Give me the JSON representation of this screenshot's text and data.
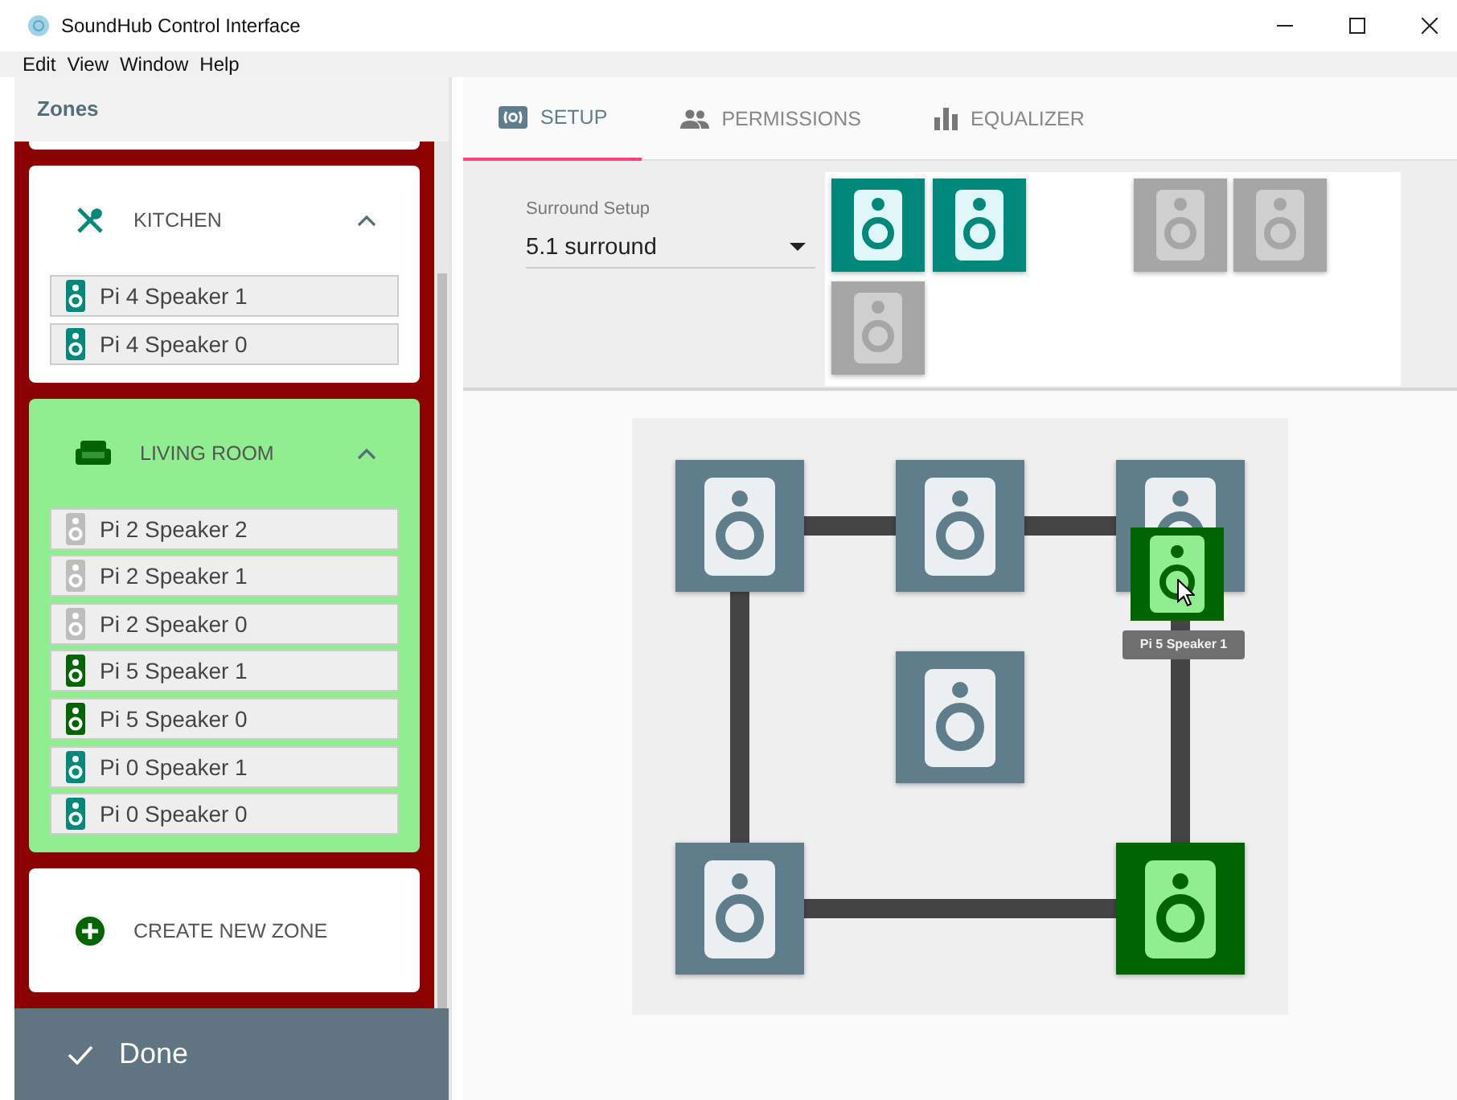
{
  "window": {
    "title": "SoundHub Control Interface"
  },
  "menu": [
    "Edit",
    "View",
    "Window",
    "Help"
  ],
  "sidebar": {
    "title": "Zones",
    "zones": [
      {
        "kind": "kitchen",
        "name": "KITCHEN",
        "color": "#ffffff",
        "expanded": true,
        "speakers": [
          {
            "name": "Pi 4 Speaker 1",
            "color": "#00897b"
          },
          {
            "name": "Pi 4 Speaker 0",
            "color": "#00897b"
          }
        ]
      },
      {
        "kind": "living_room",
        "name": "LIVING ROOM",
        "color": "#90ee90",
        "expanded": true,
        "speakers": [
          {
            "name": "Pi 2 Speaker 2",
            "color": "#bdbdbd"
          },
          {
            "name": "Pi 2 Speaker 1",
            "color": "#bdbdbd"
          },
          {
            "name": "Pi 2 Speaker 0",
            "color": "#bdbdbd"
          },
          {
            "name": "Pi 5 Speaker 1",
            "color": "#006400"
          },
          {
            "name": "Pi 5 Speaker 0",
            "color": "#006400"
          },
          {
            "name": "Pi 0 Speaker 1",
            "color": "#00897b"
          },
          {
            "name": "Pi 0 Speaker 0",
            "color": "#00897b"
          }
        ]
      }
    ],
    "create_zone": "CREATE NEW ZONE",
    "done_button": "Done"
  },
  "tabs": [
    {
      "kind": "setup",
      "label": "SETUP",
      "selected": true
    },
    {
      "kind": "permissions",
      "label": "PERMISSIONS",
      "selected": false
    },
    {
      "kind": "equalizer",
      "label": "EQUALIZER",
      "selected": false
    }
  ],
  "setup": {
    "dropdown": {
      "label": "Surround Setup",
      "value": "5.1 surround"
    },
    "palette": [
      {
        "kind": "speaker",
        "color": "#00897b"
      },
      {
        "kind": "speaker",
        "color": "#00897b"
      },
      {
        "kind": "empty"
      },
      {
        "kind": "speaker",
        "color": "#a6a6a6"
      },
      {
        "kind": "speaker",
        "color": "#a6a6a6"
      },
      {
        "kind": "empty"
      },
      {
        "kind": "speaker",
        "color": "#a6a6a6"
      }
    ]
  },
  "canvas": {
    "nodes": [
      {
        "color": "#607d8b"
      },
      {
        "color": "#607d8b"
      },
      {
        "color": "#607d8b"
      },
      {
        "color": "#607d8b"
      },
      {
        "color": "#607d8b"
      },
      {
        "color": "#006400"
      }
    ],
    "dragged": {
      "color": "#006400",
      "tooltip": "Pi 5 Speaker 1"
    }
  }
}
